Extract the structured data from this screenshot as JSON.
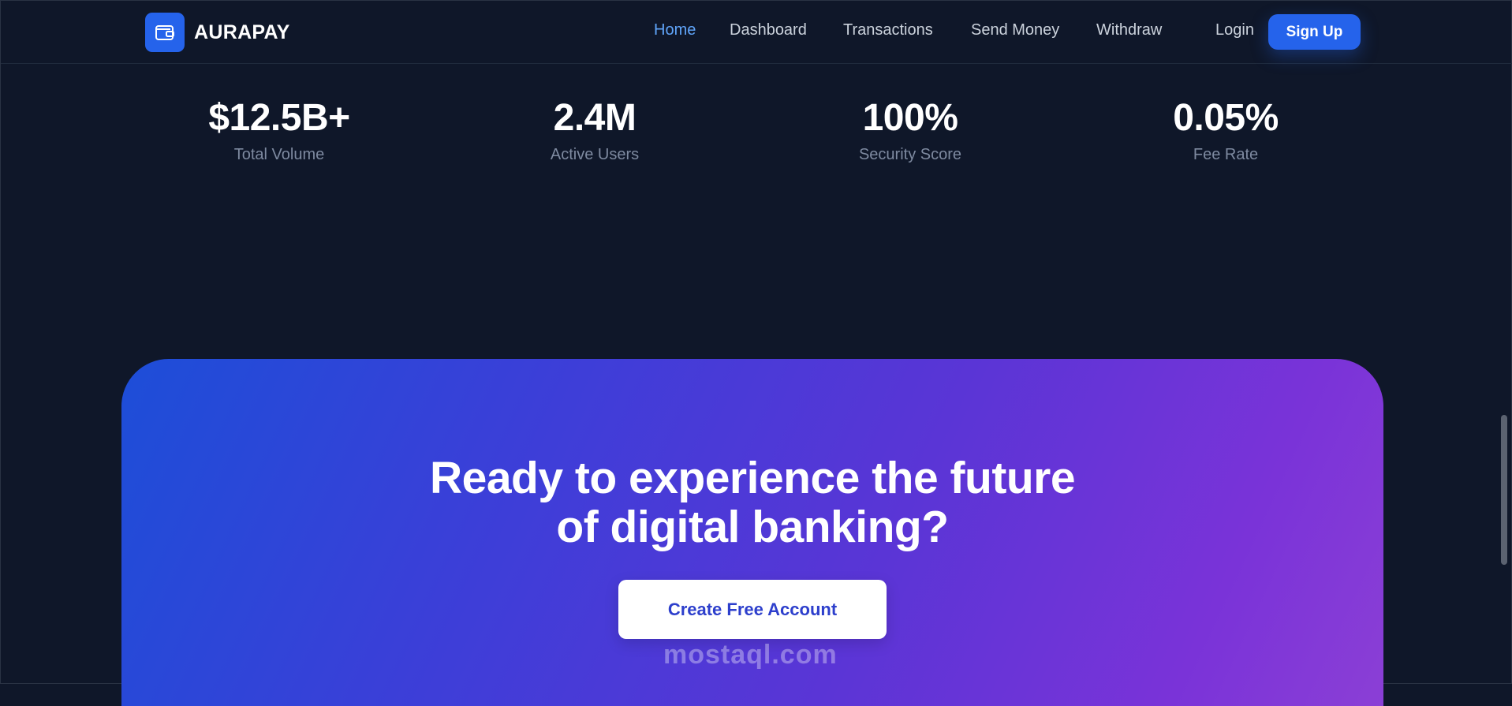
{
  "brand": {
    "name": "AURAPAY",
    "icon": "wallet-icon"
  },
  "nav": {
    "links": [
      "Home",
      "Dashboard",
      "Transactions",
      "Send Money",
      "Withdraw"
    ],
    "active": "Home",
    "login_label": "Login",
    "signup_label": "Sign Up"
  },
  "stats": [
    {
      "value": "$12.5B+",
      "label": "Total Volume"
    },
    {
      "value": "2.4M",
      "label": "Active Users"
    },
    {
      "value": "100%",
      "label": "Security Score"
    },
    {
      "value": "0.05%",
      "label": "Fee Rate"
    }
  ],
  "cta": {
    "title_line1": "Ready to experience the future",
    "title_line2": "of digital banking?",
    "button_label": "Create Free Account"
  },
  "watermark": "mostaql.com",
  "colors": {
    "background": "#0f1729",
    "accent": "#2563eb",
    "active_link": "#60a5fa",
    "gradient_start": "#1d4ed8",
    "gradient_end": "#8b3fd6"
  }
}
